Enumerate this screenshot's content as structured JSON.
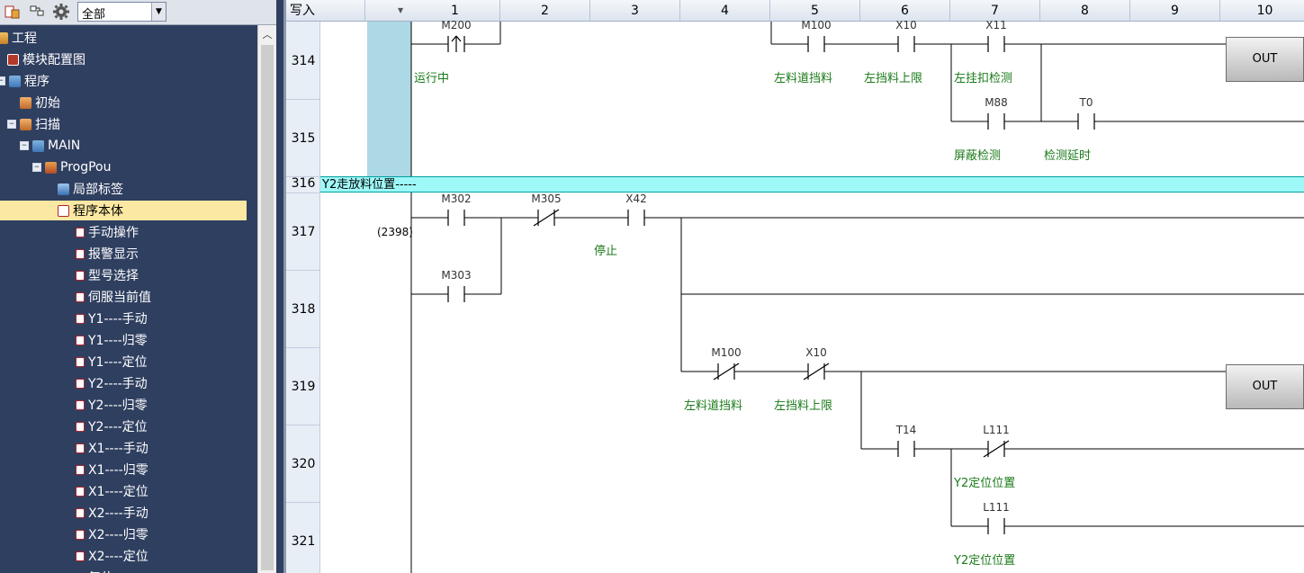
{
  "toolbar": {
    "filter_value": "全部",
    "icons": [
      "project-view-icon",
      "tree-structure-icon",
      "gear-icon"
    ]
  },
  "tree": [
    {
      "label": "工程",
      "icon": "project-icon",
      "expander": ""
    },
    {
      "label": "模块配置图",
      "icon": "module-config-icon",
      "expander": ""
    },
    {
      "label": "程序",
      "icon": "program-icon",
      "expander": "−"
    },
    {
      "label": "初始",
      "icon": "scan-icon",
      "expander": ""
    },
    {
      "label": "扫描",
      "icon": "scan-icon",
      "expander": "−"
    },
    {
      "label": "MAIN",
      "icon": "main-icon",
      "expander": "−"
    },
    {
      "label": "ProgPou",
      "icon": "pou-icon",
      "expander": "−"
    },
    {
      "label": "局部标签",
      "icon": "label-icon",
      "expander": ""
    },
    {
      "label": "程序本体",
      "icon": "body-icon",
      "expander": "",
      "selected": true
    },
    {
      "label": "手动操作",
      "icon": "subroutine-icon",
      "expander": ""
    },
    {
      "label": "报警显示",
      "icon": "subroutine-icon",
      "expander": ""
    },
    {
      "label": "型号选择",
      "icon": "subroutine-icon",
      "expander": ""
    },
    {
      "label": "伺服当前值",
      "icon": "subroutine-icon",
      "expander": ""
    },
    {
      "label": "Y1----手动",
      "icon": "subroutine-icon",
      "expander": ""
    },
    {
      "label": "Y1----归零",
      "icon": "subroutine-icon",
      "expander": ""
    },
    {
      "label": "Y1----定位",
      "icon": "subroutine-icon",
      "expander": ""
    },
    {
      "label": "Y2----手动",
      "icon": "subroutine-icon",
      "expander": ""
    },
    {
      "label": "Y2----归零",
      "icon": "subroutine-icon",
      "expander": ""
    },
    {
      "label": "Y2----定位",
      "icon": "subroutine-icon",
      "expander": ""
    },
    {
      "label": "X1----手动",
      "icon": "subroutine-icon",
      "expander": ""
    },
    {
      "label": "X1----归零",
      "icon": "subroutine-icon",
      "expander": ""
    },
    {
      "label": "X1----定位",
      "icon": "subroutine-icon",
      "expander": ""
    },
    {
      "label": "X2----手动",
      "icon": "subroutine-icon",
      "expander": ""
    },
    {
      "label": "X2----归零",
      "icon": "subroutine-icon",
      "expander": ""
    },
    {
      "label": "X2----定位",
      "icon": "subroutine-icon",
      "expander": ""
    },
    {
      "label": "复位",
      "icon": "subroutine-icon",
      "expander": ""
    }
  ],
  "editor": {
    "mode": "写入",
    "columns": [
      "1",
      "2",
      "3",
      "4",
      "5",
      "6",
      "7",
      "8",
      "9",
      "10"
    ],
    "rows": [
      "314",
      "315",
      "316",
      "317",
      "318",
      "319",
      "320",
      "321"
    ],
    "step_number": "(2398)",
    "comment_row": "Y2走放料位置-----",
    "devices": [
      {
        "id": "M200",
        "type": "rising-edge"
      },
      {
        "id": "M100",
        "type": "no"
      },
      {
        "id": "X10",
        "type": "no"
      },
      {
        "id": "X11",
        "type": "no"
      },
      {
        "id": "M88",
        "type": "no"
      },
      {
        "id": "T0",
        "type": "no"
      },
      {
        "id": "M302",
        "type": "no"
      },
      {
        "id": "M305",
        "type": "nc"
      },
      {
        "id": "X42",
        "type": "no"
      },
      {
        "id": "M303",
        "type": "no"
      },
      {
        "id": "M100",
        "type": "nc"
      },
      {
        "id": "X10",
        "type": "nc"
      },
      {
        "id": "T14",
        "type": "no"
      },
      {
        "id": "L111",
        "type": "nc"
      },
      {
        "id": "L111",
        "type": "no"
      }
    ],
    "comments": [
      "运行中",
      "左料道挡料",
      "左挡料上限",
      "左挂扣检测",
      "屏蔽检测",
      "检测延时",
      "停止",
      "左料道挡料",
      "左挡料上限",
      "Y2定位位置",
      "Y2定位位置"
    ],
    "coils": [
      "OUT",
      "OUT"
    ]
  }
}
